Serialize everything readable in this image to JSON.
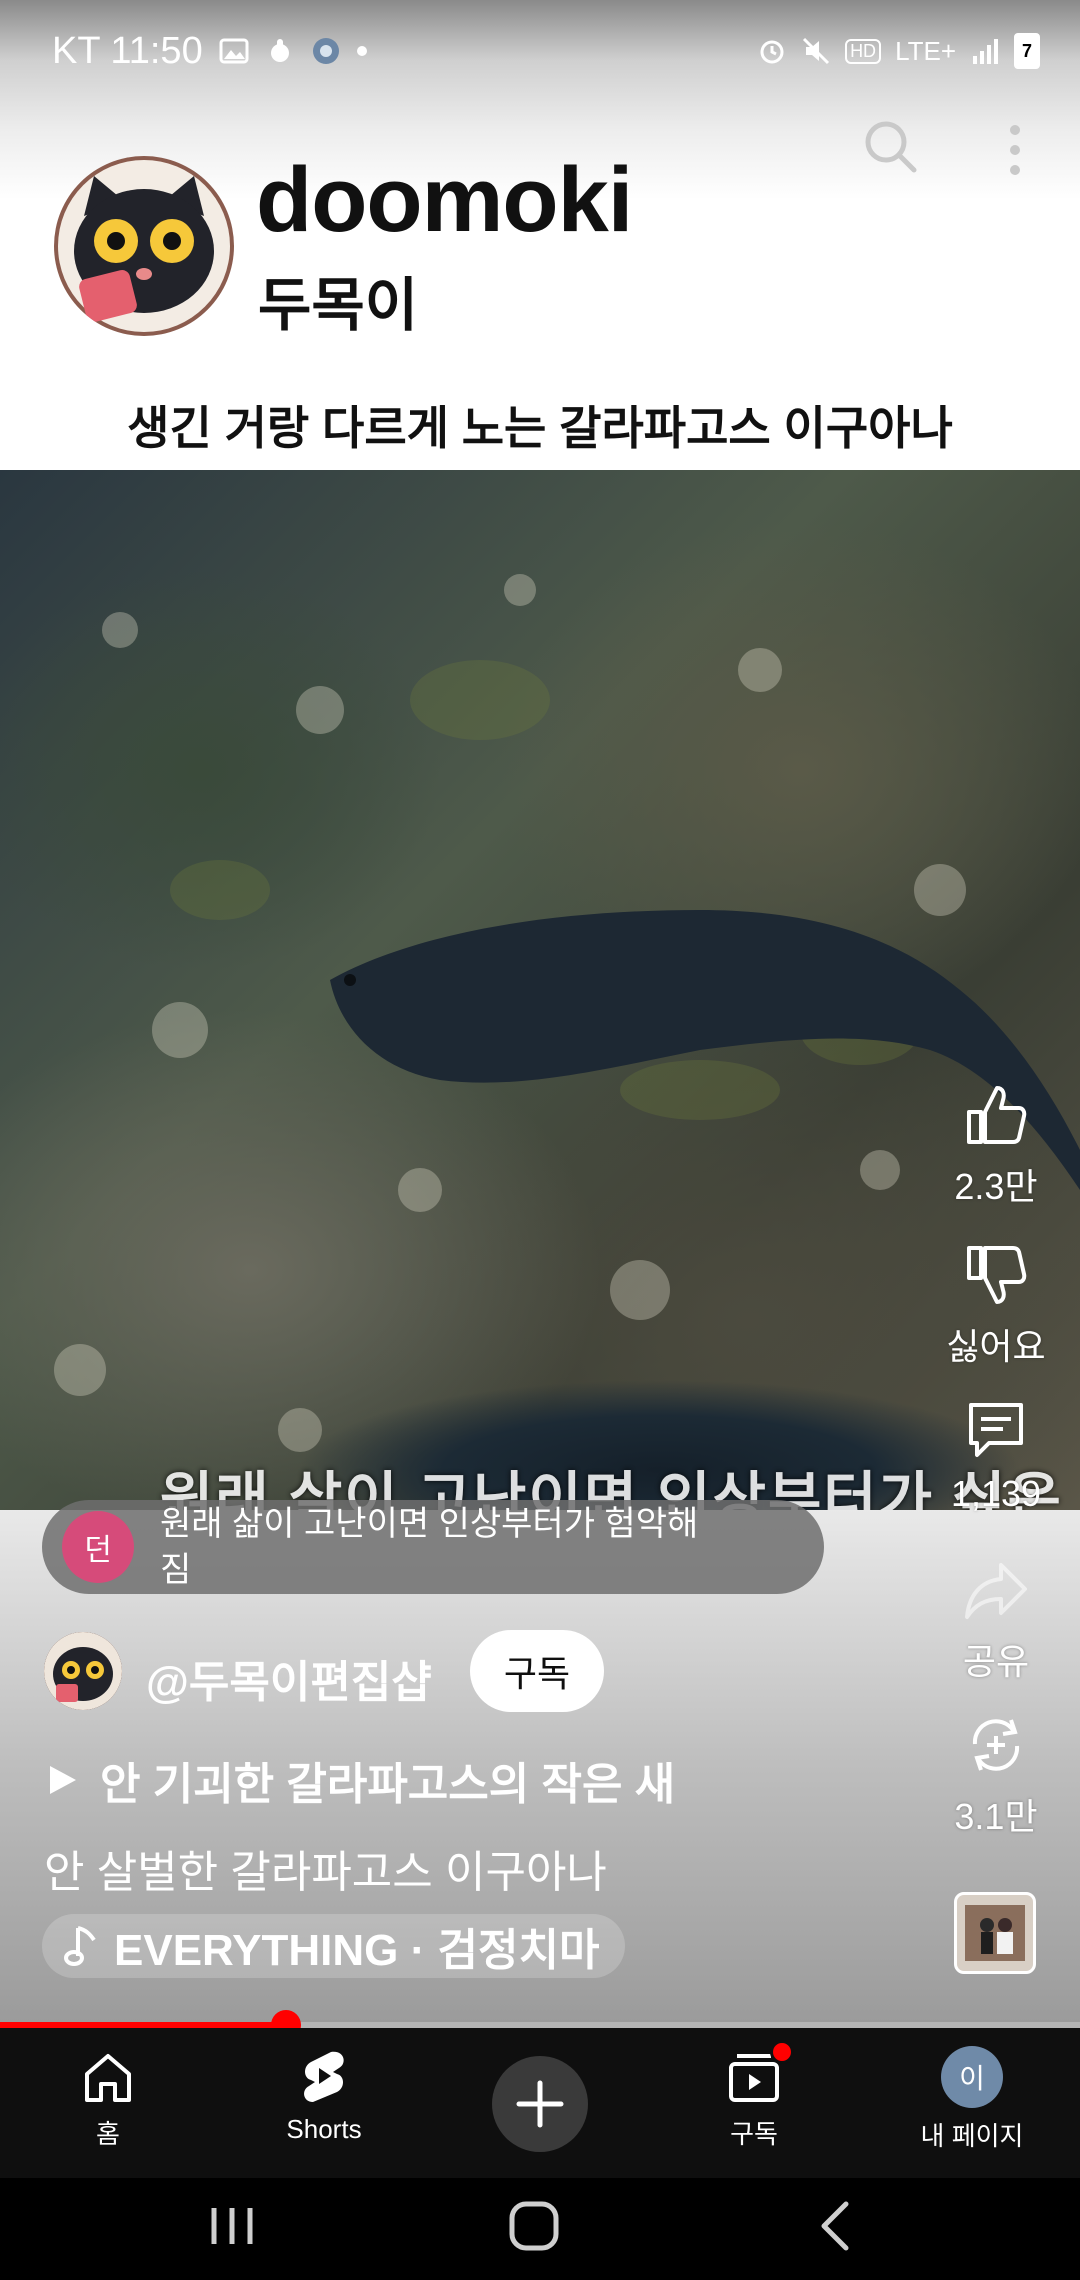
{
  "status_bar": {
    "carrier_time": "KT 11:50",
    "battery_level": "7",
    "network": "LTE+"
  },
  "header": {
    "channel_name": "doomoki",
    "channel_subname": "두목이",
    "caption": "생긴 거랑 다르게 노는 갈라파고스 이구아나"
  },
  "video": {
    "overlay_text": "원래 살이 고난이면 인상부터가 싶은데"
  },
  "comment": {
    "avatar_letter": "던",
    "text": "원래 삶이 고난이면 인상부터가 험악해짐"
  },
  "actions": {
    "like_count": "2.3만",
    "dislike_label": "싫어요",
    "comment_count": "1,139",
    "share_label": "공유",
    "remix_count": "3.1만"
  },
  "owner": {
    "handle": "@두목이편집샵",
    "subscribe_label": "구독"
  },
  "related": {
    "label": "안 기괴한 갈라파고스의 작은 새"
  },
  "title": "안 살벌한 갈라파고스 이구아나",
  "music": {
    "label": "EVERYTHING · 검정치마"
  },
  "progress": {
    "fraction": 0.265
  },
  "nav": {
    "home": "홈",
    "shorts": "Shorts",
    "subscriptions": "구독",
    "mypage": "내 페이지",
    "mypage_avatar_letter": "이"
  },
  "colors": {
    "accent_red": "#ff0000",
    "nav_bg": "#0f0f0f"
  }
}
